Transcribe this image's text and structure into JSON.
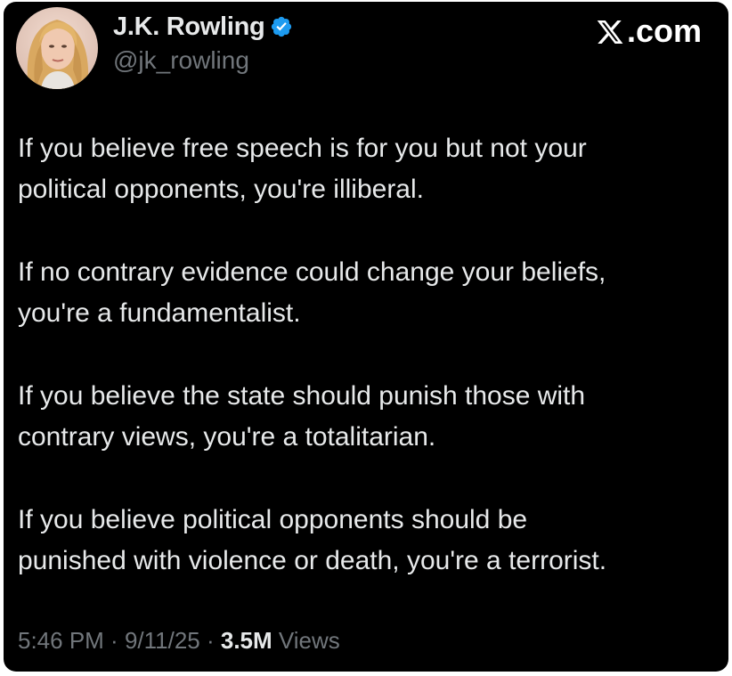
{
  "author": {
    "name": "J.K. Rowling",
    "handle": "@jk_rowling",
    "verified_icon": "verified-badge-icon",
    "badge_color": "#1d9bf0"
  },
  "brand": {
    "label": ".com",
    "icon": "x-logo-icon"
  },
  "tweet": {
    "paragraphs": [
      "If you believe free speech is for you but not your\npolitical opponents, you're illiberal.",
      "If no contrary evidence could change your beliefs,\nyou're a fundamentalist.",
      "If you believe the state should punish those with\ncontrary views, you're a totalitarian.",
      "If you believe political opponents should be\npunished with violence or death, you're a terrorist."
    ]
  },
  "meta": {
    "time": "5:46 PM",
    "sep1": " · ",
    "date": "9/11/25",
    "sep2": " · ",
    "views_count": "3.5M",
    "views_label": " Views"
  },
  "colors": {
    "background": "#000000",
    "text": "#e7e9ea",
    "muted": "#71767b"
  }
}
